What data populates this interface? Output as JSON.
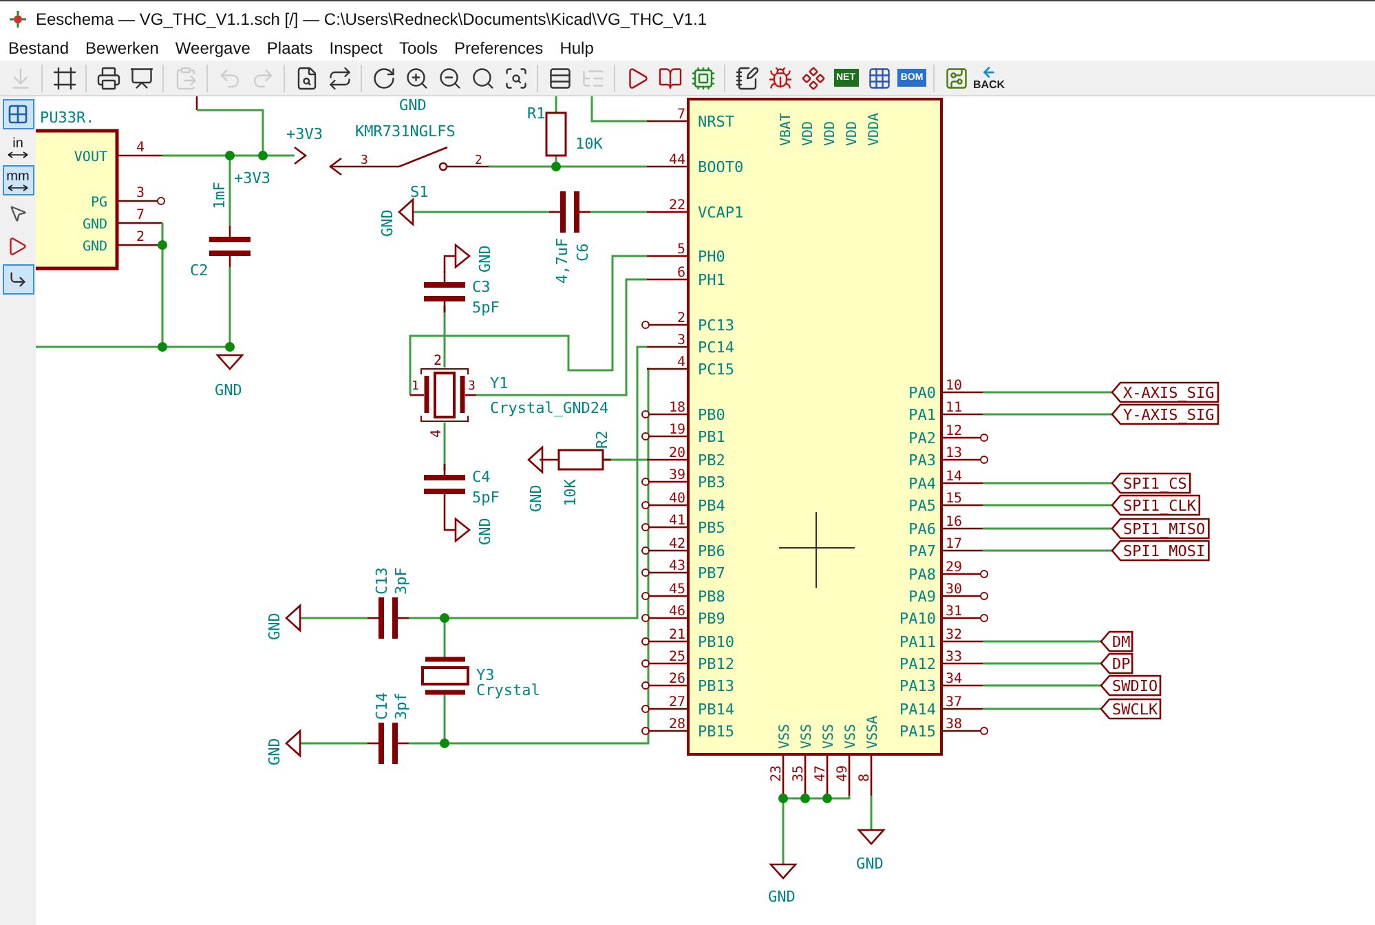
{
  "window": {
    "title": "Eeschema — VG_THC_V1.1.sch [/] — C:\\Users\\Redneck\\Documents\\Kicad\\VG_THC_V1.1"
  },
  "menu": [
    "Bestand",
    "Bewerken",
    "Weergave",
    "Plaats",
    "Inspect",
    "Tools",
    "Preferences",
    "Hulp"
  ],
  "toolbar": [
    {
      "kind": "load",
      "disabled": true
    },
    {
      "kind": "separator"
    },
    {
      "kind": "page-settings",
      "disabled": false
    },
    {
      "kind": "separator"
    },
    {
      "kind": "print",
      "disabled": false
    },
    {
      "kind": "plot",
      "disabled": false
    },
    {
      "kind": "separator"
    },
    {
      "kind": "paste",
      "disabled": true
    },
    {
      "kind": "separator"
    },
    {
      "kind": "undo",
      "disabled": true
    },
    {
      "kind": "redo",
      "disabled": true
    },
    {
      "kind": "separator"
    },
    {
      "kind": "find",
      "disabled": false
    },
    {
      "kind": "find-replace",
      "disabled": false
    },
    {
      "kind": "separator"
    },
    {
      "kind": "redraw",
      "disabled": false
    },
    {
      "kind": "zoom-in",
      "disabled": false
    },
    {
      "kind": "zoom-out",
      "disabled": false
    },
    {
      "kind": "zoom-fit",
      "disabled": false
    },
    {
      "kind": "zoom-selection",
      "disabled": false
    },
    {
      "kind": "separator"
    },
    {
      "kind": "hierarchy",
      "disabled": false
    },
    {
      "kind": "leave-sheet",
      "disabled": true
    },
    {
      "kind": "separator"
    },
    {
      "kind": "symbol-editor",
      "disabled": false
    },
    {
      "kind": "symbol-browser",
      "disabled": false
    },
    {
      "kind": "footprint-editor",
      "disabled": false
    },
    {
      "kind": "separator"
    },
    {
      "kind": "annotate",
      "disabled": false
    },
    {
      "kind": "erc",
      "disabled": false
    },
    {
      "kind": "assign-footprints",
      "disabled": false
    },
    {
      "kind": "netlist",
      "disabled": false,
      "label": "NET"
    },
    {
      "kind": "bom-grid",
      "disabled": false
    },
    {
      "kind": "bom",
      "disabled": false,
      "label": "BOM"
    },
    {
      "kind": "separator"
    },
    {
      "kind": "pcb",
      "disabled": false
    },
    {
      "kind": "back",
      "disabled": false,
      "label": "BACK"
    }
  ],
  "side_toolbar": [
    {
      "kind": "grid",
      "selected": true
    },
    {
      "kind": "units",
      "label": "in",
      "selected": false
    },
    {
      "kind": "units",
      "label": "mm",
      "selected": true
    },
    {
      "kind": "cursor",
      "selected": false
    },
    {
      "kind": "pins",
      "selected": false
    },
    {
      "kind": "angle",
      "selected": true
    }
  ],
  "schematic": {
    "regulator": {
      "reference": "PU33R.",
      "pins": [
        {
          "name": "VOUT",
          "number": "4",
          "connected": true
        },
        {
          "name": "PG",
          "number": "3",
          "connected": false
        },
        {
          "name": "GND",
          "number": "7",
          "connected": true
        },
        {
          "name": "GND",
          "number": "2",
          "connected": true
        }
      ]
    },
    "mcu": {
      "top_pins": [
        "VBAT",
        "VDD",
        "VDD",
        "VDD",
        "VDDA"
      ],
      "left_pins": [
        {
          "number": "7",
          "name": "NRST",
          "connected": true
        },
        {
          "number": "44",
          "name": "BOOT0",
          "connected": true
        },
        {
          "number": "22",
          "name": "VCAP1",
          "connected": true
        },
        {
          "number": "5",
          "name": "PH0",
          "connected": true
        },
        {
          "number": "6",
          "name": "PH1",
          "connected": true
        },
        {
          "number": "2",
          "name": "PC13",
          "connected": false
        },
        {
          "number": "3",
          "name": "PC14",
          "connected": true
        },
        {
          "number": "4",
          "name": "PC15",
          "connected": true
        },
        {
          "number": "18",
          "name": "PB0",
          "connected": false
        },
        {
          "number": "19",
          "name": "PB1",
          "connected": false
        },
        {
          "number": "20",
          "name": "PB2",
          "connected": true
        },
        {
          "number": "39",
          "name": "PB3",
          "connected": false
        },
        {
          "number": "40",
          "name": "PB4",
          "connected": false
        },
        {
          "number": "41",
          "name": "PB5",
          "connected": false
        },
        {
          "number": "42",
          "name": "PB6",
          "connected": false
        },
        {
          "number": "43",
          "name": "PB7",
          "connected": false
        },
        {
          "number": "45",
          "name": "PB8",
          "connected": false
        },
        {
          "number": "46",
          "name": "PB9",
          "connected": false
        },
        {
          "number": "21",
          "name": "PB10",
          "connected": false
        },
        {
          "number": "25",
          "name": "PB12",
          "connected": false
        },
        {
          "number": "26",
          "name": "PB13",
          "connected": false
        },
        {
          "number": "27",
          "name": "PB14",
          "connected": false
        },
        {
          "number": "28",
          "name": "PB15",
          "connected": false
        }
      ],
      "right_pins": [
        {
          "number": "10",
          "name": "PA0",
          "connected": true,
          "net_label": "X-AXIS_SIG"
        },
        {
          "number": "11",
          "name": "PA1",
          "connected": true,
          "net_label": "Y-AXIS_SIG"
        },
        {
          "number": "12",
          "name": "PA2",
          "connected": false
        },
        {
          "number": "13",
          "name": "PA3",
          "connected": false
        },
        {
          "number": "14",
          "name": "PA4",
          "connected": true,
          "net_label": "SPI1_CS"
        },
        {
          "number": "15",
          "name": "PA5",
          "connected": true,
          "net_label": "SPI1_CLK"
        },
        {
          "number": "16",
          "name": "PA6",
          "connected": true,
          "net_label": "SPI1_MISO"
        },
        {
          "number": "17",
          "name": "PA7",
          "connected": true,
          "net_label": "SPI1_MOSI"
        },
        {
          "number": "29",
          "name": "PA8",
          "connected": false
        },
        {
          "number": "30",
          "name": "PA9",
          "connected": false
        },
        {
          "number": "31",
          "name": "PA10",
          "connected": false
        },
        {
          "number": "32",
          "name": "PA11",
          "connected": true,
          "net_label": "DM"
        },
        {
          "number": "33",
          "name": "PA12",
          "connected": true,
          "net_label": "DP"
        },
        {
          "number": "34",
          "name": "PA13",
          "connected": true,
          "net_label": "SWDIO"
        },
        {
          "number": "37",
          "name": "PA14",
          "connected": true,
          "net_label": "SWCLK"
        },
        {
          "number": "38",
          "name": "PA15",
          "connected": false
        }
      ],
      "bottom_pins": [
        {
          "name": "VSS",
          "number": "23"
        },
        {
          "name": "VSS",
          "number": "35"
        },
        {
          "name": "VSS",
          "number": "47"
        },
        {
          "name": "VSS",
          "number": "49"
        },
        {
          "name": "VSSA",
          "number": "8"
        }
      ]
    },
    "parts": [
      {
        "kind": "capacitor",
        "reference": "C2",
        "value": "1mF"
      },
      {
        "kind": "switch",
        "reference": "S1",
        "value": "KMR731NGLFS",
        "pin_numbers": [
          "3",
          "2"
        ]
      },
      {
        "kind": "resistor",
        "reference": "R1",
        "value": "10K"
      },
      {
        "kind": "capacitor",
        "reference": "C6",
        "value": "4,7uF"
      },
      {
        "kind": "capacitor",
        "reference": "C3",
        "value": "5pF"
      },
      {
        "kind": "crystal4",
        "reference": "Y1",
        "value": "Crystal_GND24",
        "pin_numbers": [
          "1",
          "2",
          "3",
          "4"
        ]
      },
      {
        "kind": "capacitor",
        "reference": "C4",
        "value": "5pF"
      },
      {
        "kind": "resistor",
        "reference": "R2",
        "value": "10K"
      },
      {
        "kind": "capacitor",
        "reference": "C13",
        "value": "3pF"
      },
      {
        "kind": "crystal",
        "reference": "Y3",
        "value": "Crystal"
      },
      {
        "kind": "capacitor",
        "reference": "C14",
        "value": "3pf"
      }
    ],
    "power_labels": [
      {
        "kind": "text",
        "text": "GND"
      },
      {
        "kind": "supply",
        "text": "+3V3"
      },
      {
        "kind": "text",
        "text": "+3V3"
      },
      {
        "kind": "ground",
        "text": "GND"
      },
      {
        "kind": "ground",
        "text": "GND"
      },
      {
        "kind": "ground",
        "text": "GND"
      },
      {
        "kind": "ground",
        "text": "GND"
      },
      {
        "kind": "ground",
        "text": "GND"
      },
      {
        "kind": "ground",
        "text": "GND"
      },
      {
        "kind": "ground",
        "text": "GND"
      },
      {
        "kind": "ground",
        "text": "GND"
      },
      {
        "kind": "ground",
        "text": "GND"
      }
    ]
  }
}
